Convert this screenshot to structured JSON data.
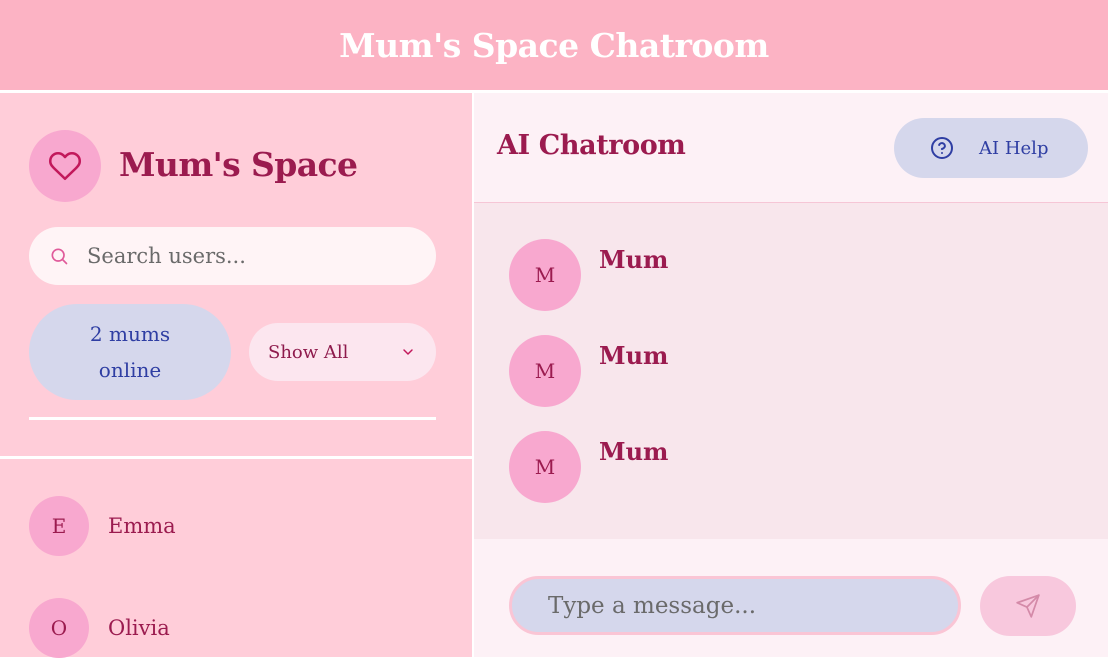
{
  "header": {
    "title": "Mum's Space Chatroom"
  },
  "sidebar": {
    "brand_title": "Mum's Space",
    "brand_icon": "heart-icon",
    "search": {
      "placeholder": "Search users...",
      "value": "",
      "icon": "search-icon"
    },
    "online_status": "2 mums online",
    "filter": {
      "selected": "Show All",
      "icon": "chevron-down-icon"
    },
    "users": [
      {
        "initial": "E",
        "name": "Emma"
      },
      {
        "initial": "O",
        "name": "Olivia"
      }
    ]
  },
  "chat": {
    "title": "AI Chatroom",
    "help_button": {
      "label": "AI Help",
      "icon": "question-circle-icon"
    },
    "messages": [
      {
        "initial": "M",
        "sender": "Mum"
      },
      {
        "initial": "M",
        "sender": "Mum"
      },
      {
        "initial": "M",
        "sender": "Mum"
      }
    ],
    "composer": {
      "placeholder": "Type a message...",
      "value": "",
      "send_icon": "send-icon"
    }
  },
  "colors": {
    "header_bg": "#fcb3c4",
    "sidebar_bg": "#ffcdd9",
    "accent": "#9b1b4f",
    "avatar_bg": "#f8a8cf",
    "pill_bg": "#d5d7ec",
    "pill_text": "#2f3ea3"
  }
}
